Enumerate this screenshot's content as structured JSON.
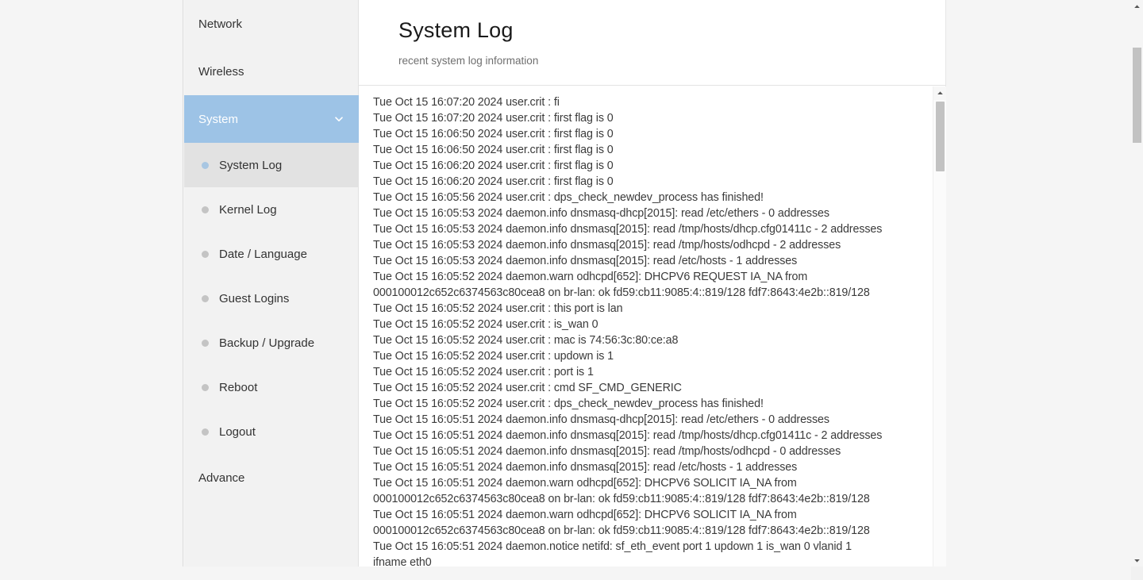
{
  "sidebar": {
    "items": [
      {
        "label": "Network",
        "type": "section",
        "state": "normal"
      },
      {
        "label": "Wireless",
        "type": "section",
        "state": "normal"
      },
      {
        "label": "System",
        "type": "section",
        "state": "expanded"
      },
      {
        "label": "Advance",
        "type": "section",
        "state": "normal"
      }
    ],
    "system_children": [
      {
        "label": "System Log",
        "selected": true
      },
      {
        "label": "Kernel Log",
        "selected": false
      },
      {
        "label": "Date / Language",
        "selected": false
      },
      {
        "label": "Guest Logins",
        "selected": false
      },
      {
        "label": "Backup / Upgrade",
        "selected": false
      },
      {
        "label": "Reboot",
        "selected": false
      },
      {
        "label": "Logout",
        "selected": false
      }
    ],
    "active_section_color": "#9dc3e6",
    "selected_item_color": "#e2e2e2",
    "selected_dot_color": "#a8c6e2",
    "dot_color": "#c4c4c4"
  },
  "header": {
    "title": "System Log",
    "subtitle": "recent system log information"
  },
  "log": {
    "lines": [
      "Tue Oct 15 16:07:20 2024 user.crit : fi",
      "Tue Oct 15 16:07:20 2024 user.crit : first flag is 0",
      "Tue Oct 15 16:06:50 2024 user.crit : first flag is 0",
      "Tue Oct 15 16:06:50 2024 user.crit : first flag is 0",
      "Tue Oct 15 16:06:20 2024 user.crit : first flag is 0",
      "Tue Oct 15 16:06:20 2024 user.crit : first flag is 0",
      "Tue Oct 15 16:05:56 2024 user.crit : dps_check_newdev_process has finished!",
      "Tue Oct 15 16:05:53 2024 daemon.info dnsmasq-dhcp[2015]: read /etc/ethers - 0 addresses",
      "Tue Oct 15 16:05:53 2024 daemon.info dnsmasq[2015]: read /tmp/hosts/dhcp.cfg01411c - 2 addresses",
      "Tue Oct 15 16:05:53 2024 daemon.info dnsmasq[2015]: read /tmp/hosts/odhcpd - 2 addresses",
      "Tue Oct 15 16:05:53 2024 daemon.info dnsmasq[2015]: read /etc/hosts - 1 addresses",
      "Tue Oct 15 16:05:52 2024 daemon.warn odhcpd[652]: DHCPV6 REQUEST IA_NA from",
      "000100012c652c6374563c80cea8 on br-lan: ok fd59:cb11:9085:4::819/128 fdf7:8643:4e2b::819/128",
      "Tue Oct 15 16:05:52 2024 user.crit : this port is lan",
      "Tue Oct 15 16:05:52 2024 user.crit : is_wan 0",
      "Tue Oct 15 16:05:52 2024 user.crit : mac is 74:56:3c:80:ce:a8",
      "Tue Oct 15 16:05:52 2024 user.crit : updown is 1",
      "Tue Oct 15 16:05:52 2024 user.crit : port is 1",
      "Tue Oct 15 16:05:52 2024 user.crit : cmd SF_CMD_GENERIC",
      "Tue Oct 15 16:05:52 2024 user.crit : dps_check_newdev_process has finished!",
      "Tue Oct 15 16:05:51 2024 daemon.info dnsmasq-dhcp[2015]: read /etc/ethers - 0 addresses",
      "Tue Oct 15 16:05:51 2024 daemon.info dnsmasq[2015]: read /tmp/hosts/dhcp.cfg01411c - 2 addresses",
      "Tue Oct 15 16:05:51 2024 daemon.info dnsmasq[2015]: read /tmp/hosts/odhcpd - 0 addresses",
      "Tue Oct 15 16:05:51 2024 daemon.info dnsmasq[2015]: read /etc/hosts - 1 addresses",
      "Tue Oct 15 16:05:51 2024 daemon.warn odhcpd[652]: DHCPV6 SOLICIT IA_NA from",
      "000100012c652c6374563c80cea8 on br-lan: ok fd59:cb11:9085:4::819/128 fdf7:8643:4e2b::819/128",
      "Tue Oct 15 16:05:51 2024 daemon.warn odhcpd[652]: DHCPV6 SOLICIT IA_NA from",
      "000100012c652c6374563c80cea8 on br-lan: ok fd59:cb11:9085:4::819/128 fdf7:8643:4e2b::819/128",
      "Tue Oct 15 16:05:51 2024 daemon.notice netifd: sf_eth_event port 1 updown 1 is_wan 0 vlanid 1",
      "ifname eth0"
    ]
  },
  "scrollbars": {
    "log_vertical_position": "top",
    "page_vertical_position": "upper",
    "page_horizontal_position": "left"
  }
}
